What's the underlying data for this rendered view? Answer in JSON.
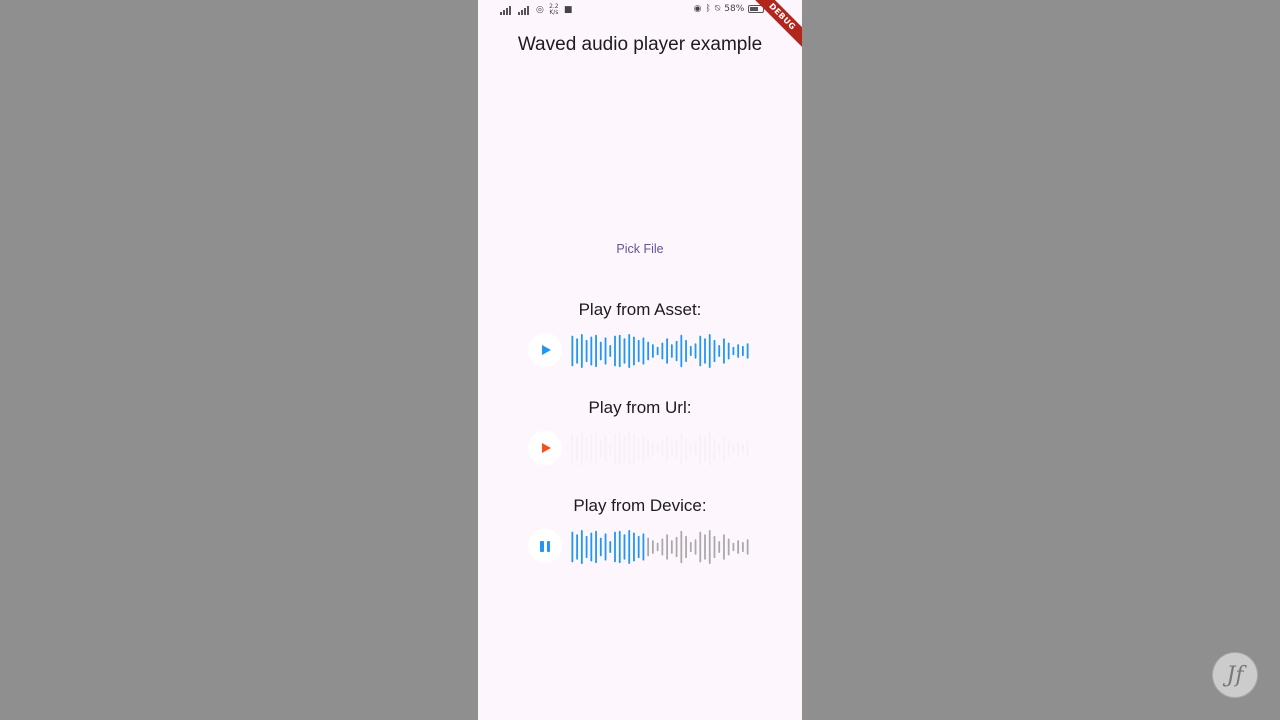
{
  "app": {
    "title": "Waved audio player example",
    "debug_banner": "DEBUG"
  },
  "status_bar": {
    "net_speed_value": "2.2",
    "net_speed_unit": "K/s",
    "battery_percent": "58%",
    "time_partial": "1"
  },
  "pick_file": {
    "label": "Pick File"
  },
  "players": [
    {
      "label": "Play from Asset:",
      "state": "paused",
      "button_icon": "play-icon",
      "button_color": "#2196f3",
      "progress": 1.0,
      "played_color": "#2196f3",
      "unplayed_color": "#2196f3"
    },
    {
      "label": "Play from Url:",
      "state": "loading",
      "button_icon": "play-icon",
      "button_color": "#f4511e",
      "progress": 0.0,
      "played_color": "#e0e0e0",
      "unplayed_color": "#e0e0e0"
    },
    {
      "label": "Play from Device:",
      "state": "playing",
      "button_icon": "pause-icon",
      "button_color": "#2196f3",
      "progress": 0.42,
      "played_color": "#2196f3",
      "unplayed_color": "#a9a9a9"
    }
  ],
  "watermark": {
    "text": "Jf"
  }
}
